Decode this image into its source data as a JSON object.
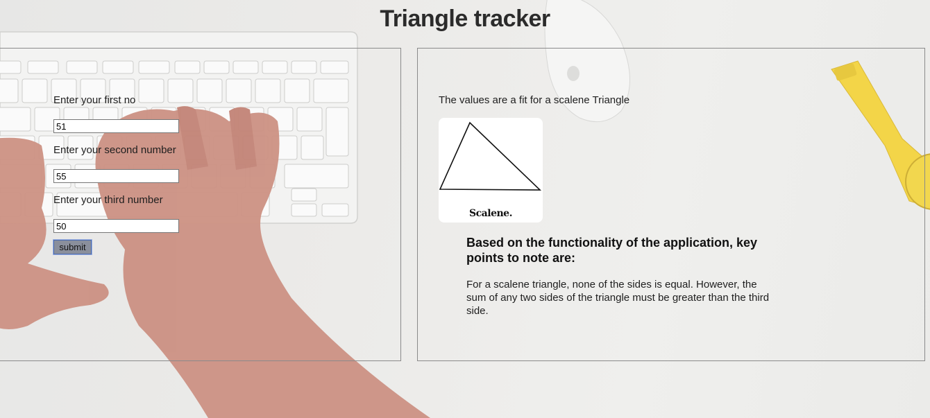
{
  "header": {
    "title": "Triangle tracker"
  },
  "form": {
    "first_label": "Enter your first no",
    "first_value": "51",
    "second_label": "Enter your second number",
    "second_value": "55",
    "third_label": "Enter your third number",
    "third_value": "50",
    "submit_label": "submit"
  },
  "result": {
    "message": "The values are a fit for a scalene Triangle",
    "image_caption": "Scalene.",
    "image_icon": "scalene-triangle-diagram"
  },
  "notes": {
    "heading": "Based on the functionality of the application, key points to note are:",
    "body": "For a scalene triangle, none of the sides is equal. However, the sum of any two sides of the triangle must be greater than the third side."
  },
  "colors": {
    "background": "#ecebe9",
    "panel_border": "#8a8a8a",
    "watch_yellow": "#f4d33a",
    "skin": "#c98a7a",
    "submit_bg": "#8a8f9c"
  }
}
